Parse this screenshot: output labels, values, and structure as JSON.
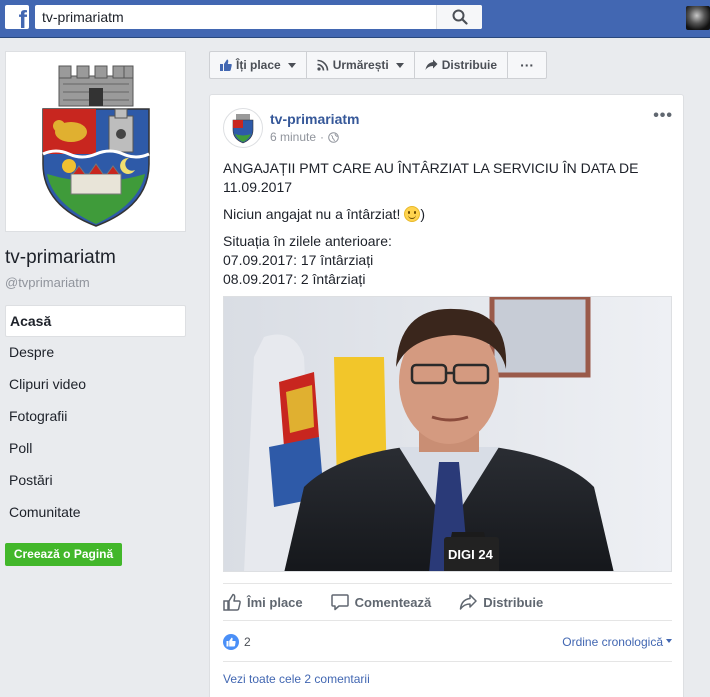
{
  "topbar": {
    "logo_letter": "f",
    "search_value": "tv-primariatm"
  },
  "page": {
    "name": "tv-primariatm",
    "handle": "@tvprimariatm",
    "nav": [
      "Acasă",
      "Despre",
      "Clipuri video",
      "Fotografii",
      "Poll",
      "Postări",
      "Comunitate"
    ],
    "create_page": "Creează o Pagină"
  },
  "actions": {
    "like": "Îți place",
    "follow": "Urmărești",
    "share": "Distribuie",
    "more": "···"
  },
  "post": {
    "author": "tv-primariatm",
    "time": "6 minute",
    "text": {
      "headline": "ANGAJAȚII PMT CARE AU ÎNTÂRZIAT LA SERVICIU ÎN DATA DE 11.09.2017",
      "none_late_prefix": "Niciun angajat nu a întârziat!",
      "none_late_suffix": ")",
      "history_title": "Situația în zilele anterioare:",
      "history_1": "07.09.2017: 17 întârziați",
      "history_2": "08.09.2017: 2 întârziați"
    },
    "image_logo": "DIGI 24",
    "buttons": {
      "like": "Îmi place",
      "comment": "Comentează",
      "share": "Distribuie"
    },
    "reaction_count": "2",
    "order": "Ordine cronologică",
    "see_comments": "Vezi toate cele 2 comentarii"
  },
  "colors": {
    "brand": "#4267b2",
    "create_button": "#42b72a",
    "link": "#365899"
  }
}
